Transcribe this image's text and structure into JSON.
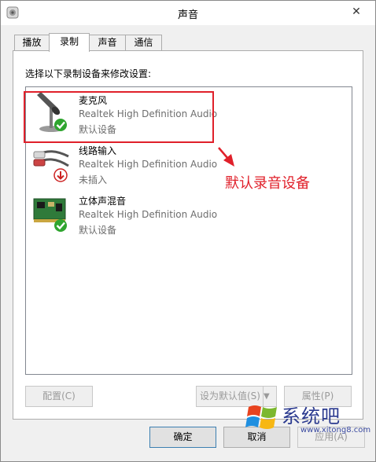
{
  "window": {
    "title": "声音",
    "close_glyph": "✕"
  },
  "tabs": [
    {
      "label": "播放",
      "active": false
    },
    {
      "label": "录制",
      "active": true
    },
    {
      "label": "声音",
      "active": false
    },
    {
      "label": "通信",
      "active": false
    }
  ],
  "instruction": "选择以下录制设备来修改设置:",
  "devices": [
    {
      "name": "麦克风",
      "driver": "Realtek High Definition Audio",
      "status": "默认设备",
      "icon": "microphone-icon",
      "badge": "green-check"
    },
    {
      "name": "线路输入",
      "driver": "Realtek High Definition Audio",
      "status": "未插入",
      "icon": "line-in-cable-icon",
      "badge": "red-down-arrow"
    },
    {
      "name": "立体声混音",
      "driver": "Realtek High Definition Audio",
      "status": "默认设备",
      "icon": "sound-card-icon",
      "badge": "green-check"
    }
  ],
  "annotation": {
    "text": "默认录音设备",
    "color": "#e0202a"
  },
  "buttons": {
    "configure": "配置(C)",
    "set_default": "设为默认值(S)",
    "properties": "属性(P)",
    "ok": "确定",
    "cancel": "取消",
    "apply": "应用(A)"
  },
  "watermark": {
    "brand": "系统吧",
    "url": "www.xitong8.com"
  }
}
